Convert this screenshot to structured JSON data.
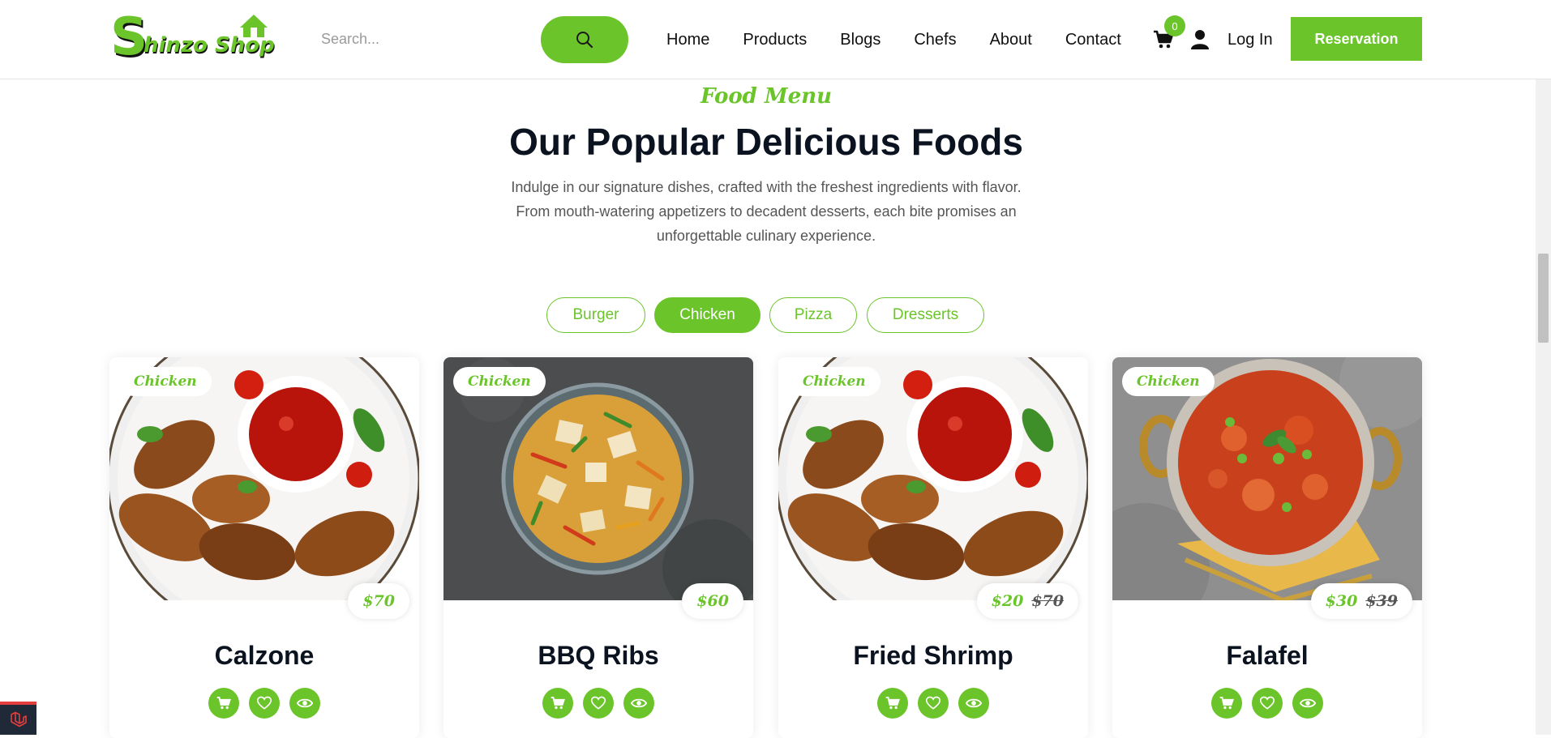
{
  "brand": {
    "logo_text": "Shinzo Shop",
    "accent": "#6ac42a",
    "dark": "#0b1320"
  },
  "search": {
    "placeholder": "Search..."
  },
  "nav": {
    "items": [
      "Home",
      "Products",
      "Blogs",
      "Chefs",
      "About",
      "Contact"
    ]
  },
  "header": {
    "cart_count": "0",
    "login": "Log In",
    "reservation": "Reservation"
  },
  "section": {
    "eyebrow": "Food Menu",
    "title": "Our Popular Delicious Foods",
    "description": "Indulge in our signature dishes, crafted with the freshest ingredients with flavor. From mouth-watering appetizers to decadent desserts, each bite promises an unforgettable culinary experience."
  },
  "filters": [
    {
      "label": "Burger",
      "active": false
    },
    {
      "label": "Chicken",
      "active": true
    },
    {
      "label": "Pizza",
      "active": false
    },
    {
      "label": "Dresserts",
      "active": false
    }
  ],
  "products": [
    {
      "name": "Calzone",
      "tag": "Chicken",
      "price": "$70",
      "old_price": "",
      "image": "chicken-wings-plate"
    },
    {
      "name": "BBQ Ribs",
      "tag": "Chicken",
      "price": "$60",
      "old_price": "",
      "image": "vegetable-paneer-bowl"
    },
    {
      "name": "Fried Shrimp",
      "tag": "Chicken",
      "price": "$20",
      "old_price": "$70",
      "image": "chicken-wings-plate"
    },
    {
      "name": "Falafel",
      "tag": "Chicken",
      "price": "$30",
      "old_price": "$39",
      "image": "curry-pot"
    }
  ],
  "icons": {
    "search": "search-icon",
    "cart": "cart-icon",
    "user": "user-icon",
    "add_to_cart": "cart-icon",
    "wishlist": "heart-icon",
    "quick_view": "eye-icon"
  }
}
